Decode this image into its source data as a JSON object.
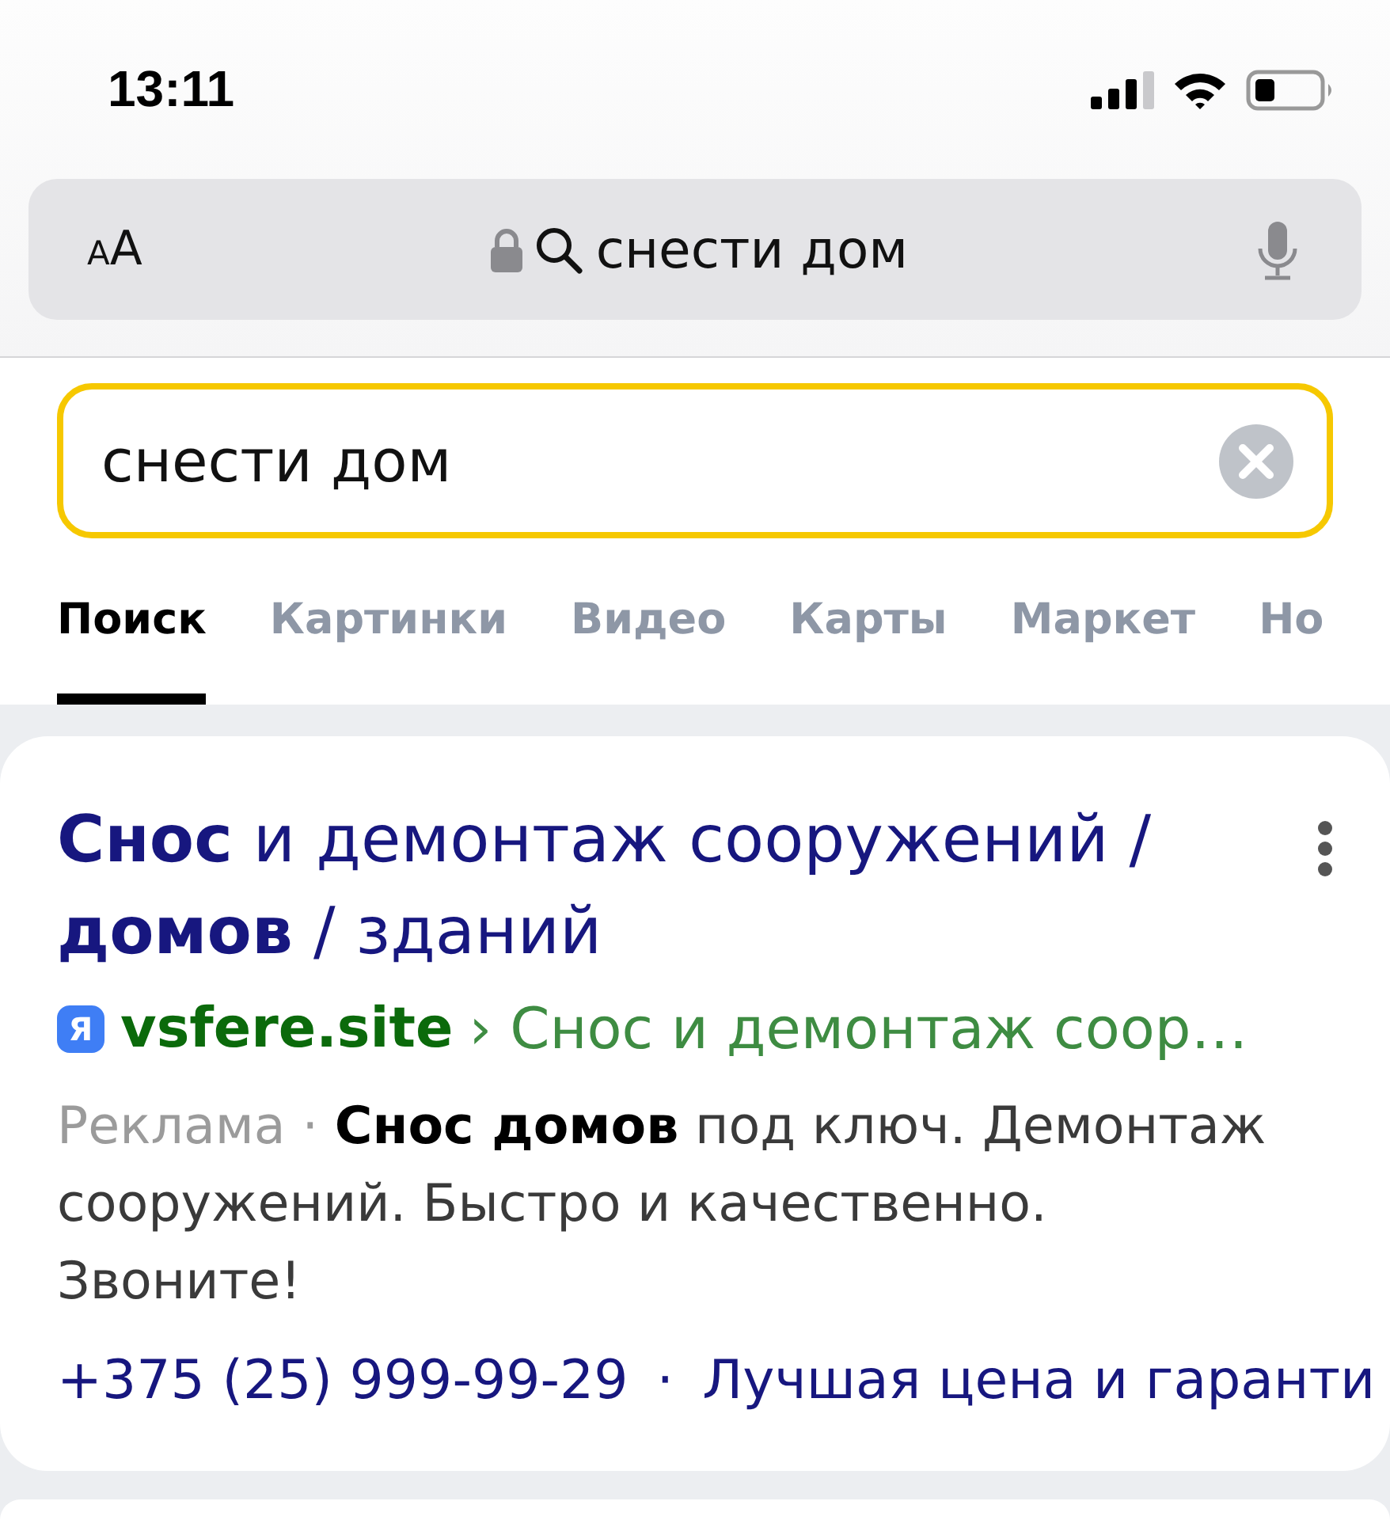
{
  "status_bar": {
    "time": "13:11"
  },
  "address_bar": {
    "text_size_button": "AA",
    "text": "снести дом"
  },
  "search": {
    "value": "снести дом"
  },
  "tabs": [
    {
      "label": "Поиск",
      "selected": true
    },
    {
      "label": "Картинки",
      "selected": false
    },
    {
      "label": "Видео",
      "selected": false
    },
    {
      "label": "Карты",
      "selected": false
    },
    {
      "label": "Маркет",
      "selected": false
    },
    {
      "label": "Но",
      "selected": false
    }
  ],
  "results": [
    {
      "title": "**Снос** и демонтаж сооружений / **домов** / зданий",
      "favicon": "Я",
      "domain": "vsfere.site",
      "breadcrumb": {
        "separator": "›",
        "text": "Снос и демонтаж соор…"
      },
      "ad_label": "Реклама",
      "ad_separator": "·",
      "snippet": "**Снос домов** под ключ. Демонтаж сооружений. Быстро и качественно. Звоните!",
      "sitelinks": [
        {
          "label": "+375 (25) 999-99-29"
        },
        {
          "separator": "·",
          "label": "Лучшая цена и гаранти"
        }
      ]
    }
  ]
}
